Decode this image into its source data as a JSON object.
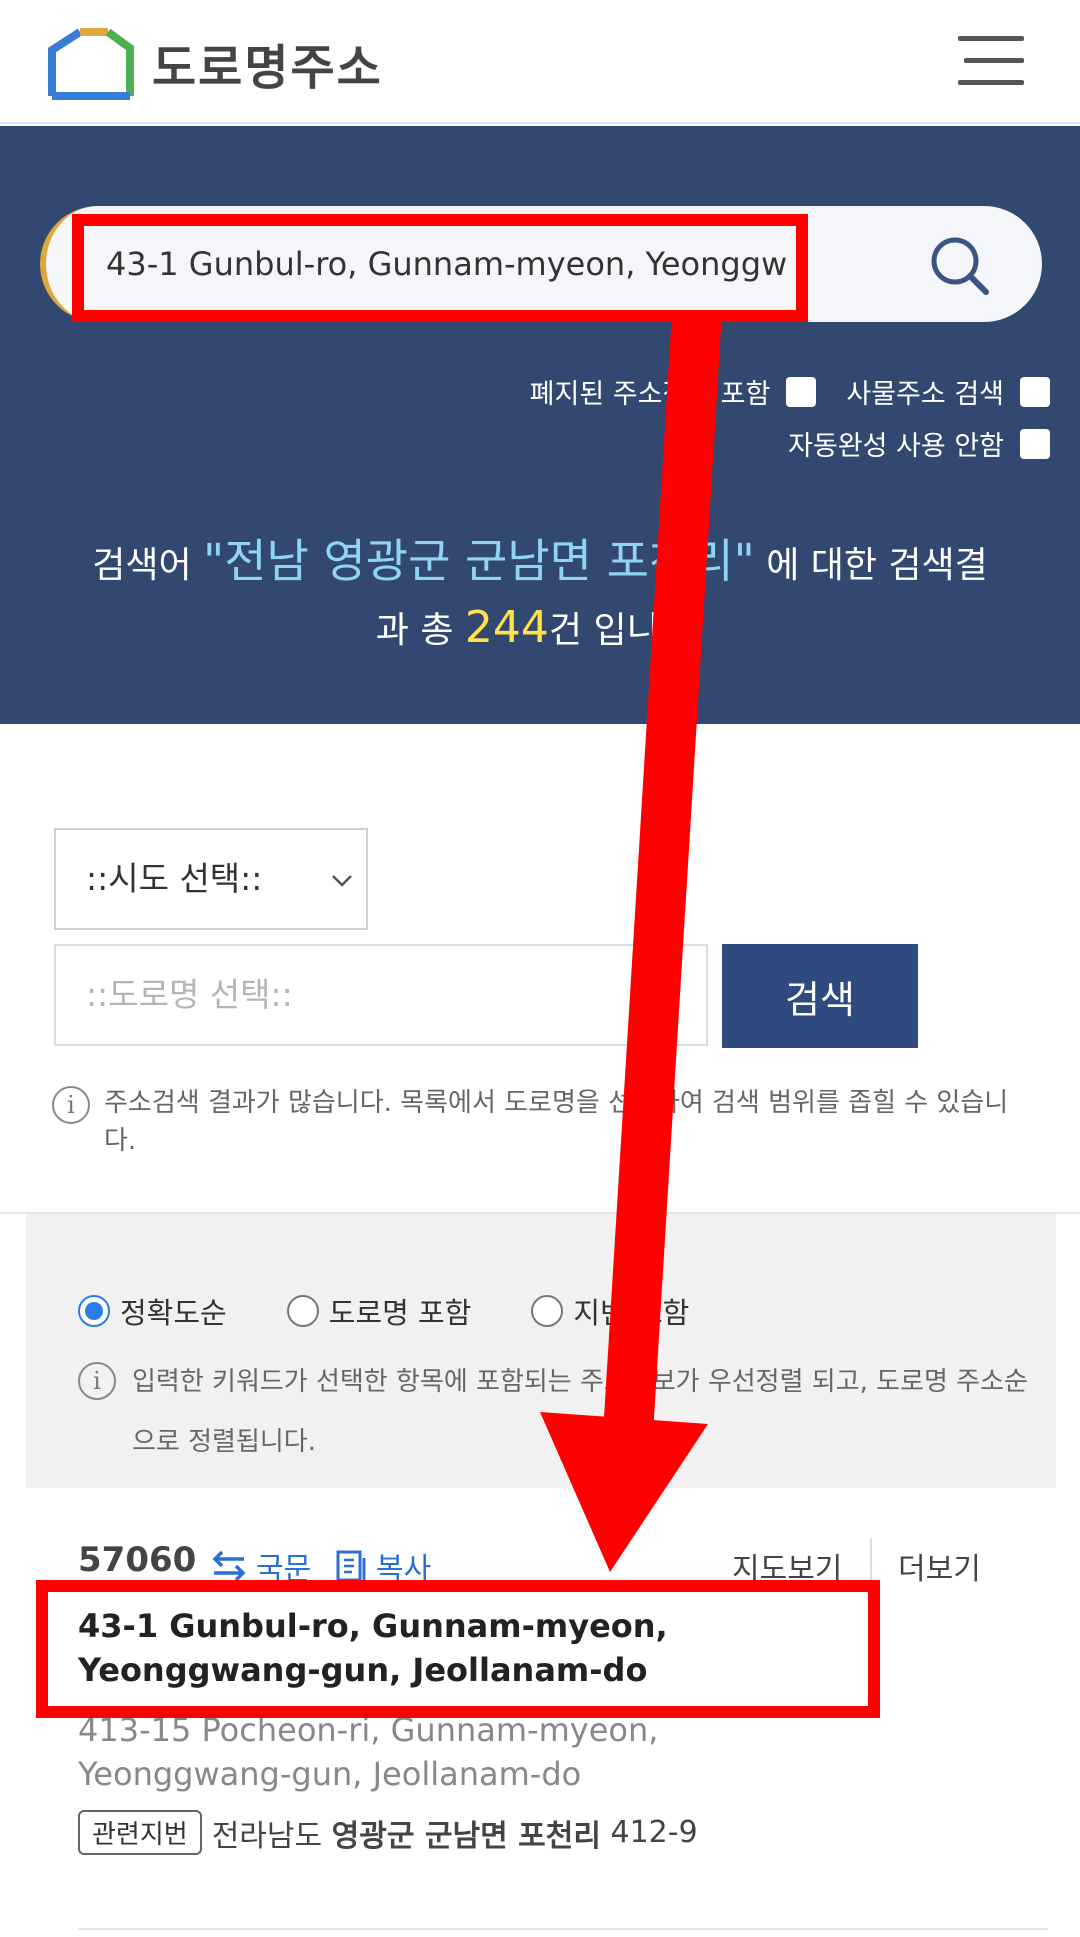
{
  "header": {
    "logo_text": "도로명주소",
    "logo_icon": "house-logo-icon",
    "menu_icon": "hamburger-menu-icon"
  },
  "search": {
    "value": "43-1 Gunbul-ro, Gunnam-myeon, Yeonggw",
    "icon": "search-icon"
  },
  "options": {
    "include_abolished": "폐지된 주소정보 포함",
    "object_address_search": "사물주소 검색",
    "disable_autocomplete": "자동완성 사용 안함"
  },
  "summary": {
    "prefix": "검색어",
    "keyword": "\"전남 영광군 군남면 포천리\"",
    "suffix": "에 대한 검색결",
    "line2_prefix": "과 총",
    "count": "244",
    "line2_suffix": "건 입니다."
  },
  "filter": {
    "sido_select": "::시도 선택::",
    "road_select_placeholder": "::도로명 선택::",
    "search_button": "검색",
    "notice": "주소검색 결과가 많습니다. 목록에서 도로명을 선택하여 검색 범위를 좁힐 수 있습니다."
  },
  "sort": {
    "options": [
      "정확도순",
      "도로명 포함",
      "지번 포함"
    ],
    "selected": "정확도순",
    "notice": "입력한 키워드가 선택한 항목에 포함되는 주소정보가 우선정렬 되고, 도로명 주소순으로 정렬됩니다."
  },
  "result": {
    "zip": "57060",
    "korean_label": "국문",
    "copy_label": "복사",
    "map_label": "지도보기",
    "more_label": "더보기",
    "road_address": "43-1 Gunbul-ro, Gunnam-myeon, Yeonggwang-gun, Jeollanam-do",
    "jibun_address": "413-15 Pocheon-ri, Gunnam-myeon, Yeonggwang-gun, Jeollanam-do",
    "related_tag": "관련지번",
    "related_province": "전라남도",
    "related_area": "영광군 군남면 포천리",
    "related_number": "412-9"
  },
  "colors": {
    "hero_bg": "#334870",
    "keyword": "#8fd3f5",
    "count": "#ffe14d",
    "search_button": "#2e4a7e",
    "link_blue": "#2b6fd6",
    "annotation": "#ff0000"
  }
}
